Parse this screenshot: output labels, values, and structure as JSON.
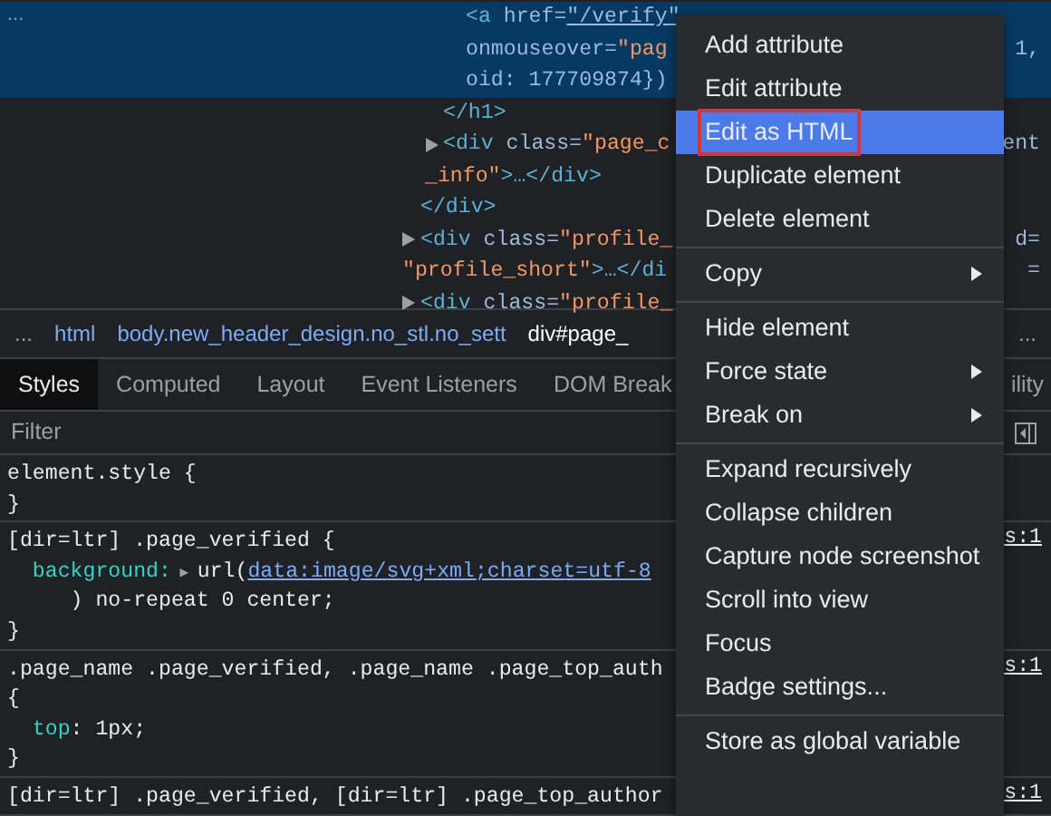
{
  "elements_panel": {
    "row_menu": "...",
    "dom_tree": [
      {
        "closing": "</div>",
        "children": [
          {
            "closing": "</h1>",
            "children": [
              {
                "expandable": false,
                "selected": true,
                "lines": [
                  {
                    "tokens": [
                      {
                        "kind": "tag",
                        "t": "<a"
                      },
                      {
                        "kind": "attr",
                        "t": " href="
                      },
                      {
                        "kind": "link",
                        "t": "\"/verify\""
                      }
                    ]
                  },
                  {
                    "tokens": [
                      {
                        "kind": "attr",
                        "t": "onmouseover="
                      },
                      {
                        "kind": "val",
                        "t": "\"pag"
                      }
                    ],
                    "aside": "1,"
                  },
                  {
                    "tokens": [
                      {
                        "kind": "attr",
                        "t": "oid: 177709874})"
                      }
                    ]
                  }
                ]
              }
            ]
          },
          {
            "expandable": true,
            "selected": false,
            "lines": [
              {
                "tokens": [
                  {
                    "kind": "tag",
                    "t": "<div"
                  },
                  {
                    "kind": "attr",
                    "t": " class="
                  },
                  {
                    "kind": "val",
                    "t": "\"page_c"
                  }
                ],
                "aside": "ent"
              },
              {
                "tokens": [
                  {
                    "kind": "val",
                    "t": "_info\""
                  },
                  {
                    "kind": "tag",
                    "t": ">…</div>"
                  }
                ]
              }
            ]
          }
        ]
      },
      {
        "expandable": true,
        "selected": false,
        "lines": [
          {
            "tokens": [
              {
                "kind": "tag",
                "t": "<div"
              },
              {
                "kind": "attr",
                "t": " class="
              },
              {
                "kind": "val",
                "t": "\"profile_"
              }
            ],
            "aside": "d="
          },
          {
            "tokens": [
              {
                "kind": "val",
                "t": "\"profile_short\""
              },
              {
                "kind": "tag",
                "t": ">…</di"
              }
            ],
            "aside": "="
          }
        ]
      },
      {
        "expandable": true,
        "selected": false,
        "lines": [
          {
            "tokens": [
              {
                "kind": "tag",
                "t": "<div"
              },
              {
                "kind": "attr",
                "t": " class="
              },
              {
                "kind": "val",
                "t": "\"profile_"
              }
            ]
          }
        ]
      }
    ]
  },
  "breadcrumb": {
    "more_left": "...",
    "items": [
      {
        "label": "html",
        "selected": false
      },
      {
        "label": "body.new_header_design.no_stl.no_sett",
        "selected": false
      },
      {
        "label": "div#page_",
        "selected": true
      }
    ],
    "more_right": "..."
  },
  "tabs": [
    {
      "label": "Styles",
      "selected": true
    },
    {
      "label": "Computed",
      "selected": false
    },
    {
      "label": "Layout",
      "selected": false
    },
    {
      "label": "Event Listeners",
      "selected": false
    },
    {
      "label": "DOM Break",
      "selected": false
    }
  ],
  "tabs_aside": "ility",
  "filter": {
    "placeholder": "Filter"
  },
  "rules": [
    {
      "lines": [
        [
          {
            "kind": "sel",
            "t": "element.style {"
          }
        ],
        [
          {
            "kind": "sel",
            "t": "}"
          }
        ]
      ]
    },
    {
      "source": "s:1",
      "lines": [
        [
          {
            "kind": "sel",
            "t": "[dir=ltr] .page_verified {"
          }
        ],
        [
          {
            "kind": "prop",
            "t": "  background:"
          },
          {
            "kind": "tri",
            "t": " ▶ "
          },
          {
            "kind": "plain",
            "t": "url("
          },
          {
            "kind": "link",
            "t": "data:image/svg+xml;charset=utf-8"
          }
        ],
        [
          {
            "kind": "plain",
            "t": "     ) no-repeat 0 center;"
          }
        ],
        [
          {
            "kind": "sel",
            "t": "}"
          }
        ]
      ]
    },
    {
      "source": "s:1",
      "lines": [
        [
          {
            "kind": "sel",
            "t": ".page_name .page_verified, .page_name .page_top_auth"
          }
        ],
        [
          {
            "kind": "sel",
            "t": "{"
          }
        ],
        [
          {
            "kind": "prop",
            "t": "  top"
          },
          {
            "kind": "plain",
            "t": ": 1px;"
          }
        ],
        [
          {
            "kind": "sel",
            "t": "}"
          }
        ]
      ]
    },
    {
      "source": "s:1",
      "lines": [
        [
          {
            "kind": "sel",
            "t": "[dir=ltr] .page_verified, [dir=ltr] .page_top_author"
          }
        ]
      ]
    }
  ],
  "context_menu": {
    "groups": [
      [
        {
          "label": "Add attribute",
          "selected": false,
          "highlighted": false,
          "submenu": false
        },
        {
          "label": "Edit attribute",
          "selected": false,
          "highlighted": false,
          "submenu": false
        },
        {
          "label": "Edit as HTML",
          "selected": true,
          "highlighted": true,
          "submenu": false
        },
        {
          "label": "Duplicate element",
          "selected": false,
          "highlighted": false,
          "submenu": false
        },
        {
          "label": "Delete element",
          "selected": false,
          "highlighted": false,
          "submenu": false
        }
      ],
      [
        {
          "label": "Copy",
          "selected": false,
          "highlighted": false,
          "submenu": true
        }
      ],
      [
        {
          "label": "Hide element",
          "selected": false,
          "highlighted": false,
          "submenu": false
        },
        {
          "label": "Force state",
          "selected": false,
          "highlighted": false,
          "submenu": true
        },
        {
          "label": "Break on",
          "selected": false,
          "highlighted": false,
          "submenu": true
        }
      ],
      [
        {
          "label": "Expand recursively",
          "selected": false,
          "highlighted": false,
          "submenu": false
        },
        {
          "label": "Collapse children",
          "selected": false,
          "highlighted": false,
          "submenu": false
        },
        {
          "label": "Capture node screenshot",
          "selected": false,
          "highlighted": false,
          "submenu": false
        },
        {
          "label": "Scroll into view",
          "selected": false,
          "highlighted": false,
          "submenu": false
        },
        {
          "label": "Focus",
          "selected": false,
          "highlighted": false,
          "submenu": false
        },
        {
          "label": "Badge settings...",
          "selected": false,
          "highlighted": false,
          "submenu": false
        }
      ],
      [
        {
          "label": "Store as global variable",
          "selected": false,
          "highlighted": false,
          "submenu": false
        }
      ]
    ]
  }
}
